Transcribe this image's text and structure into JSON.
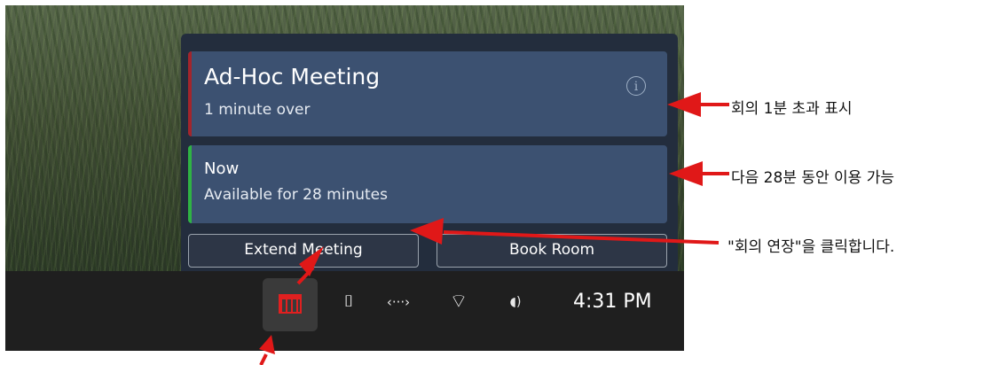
{
  "flyout": {
    "current_meeting": {
      "title": "Ad-Hoc Meeting",
      "status": "1 minute over",
      "status_color": "#a3252c",
      "info_icon": "info-icon",
      "info_glyph": "i"
    },
    "next_slot": {
      "title": "Now",
      "status": "Available for 28 minutes",
      "status_color": "#2fb344"
    },
    "buttons": {
      "extend_label": "Extend Meeting",
      "book_label": "Book Room"
    }
  },
  "taskbar": {
    "calendar_icon": "calendar-icon",
    "usb_glyph": "⌷",
    "network_glyph": "‹···›",
    "wifi_glyph": "⌔",
    "volume_glyph": "◖)",
    "time": "4:31 PM"
  },
  "annotations": {
    "over_label": "회의 1분 초과 표시",
    "available_label": "다음 28분 동안 이용 가능",
    "click_label": "\"회의 연장\"을 클릭합니다."
  },
  "colors": {
    "flyout_bg": "#232d3d",
    "card_bg": "#3c5171",
    "arrow": "#e01818",
    "taskbar_bg": "#1f1f1f"
  }
}
